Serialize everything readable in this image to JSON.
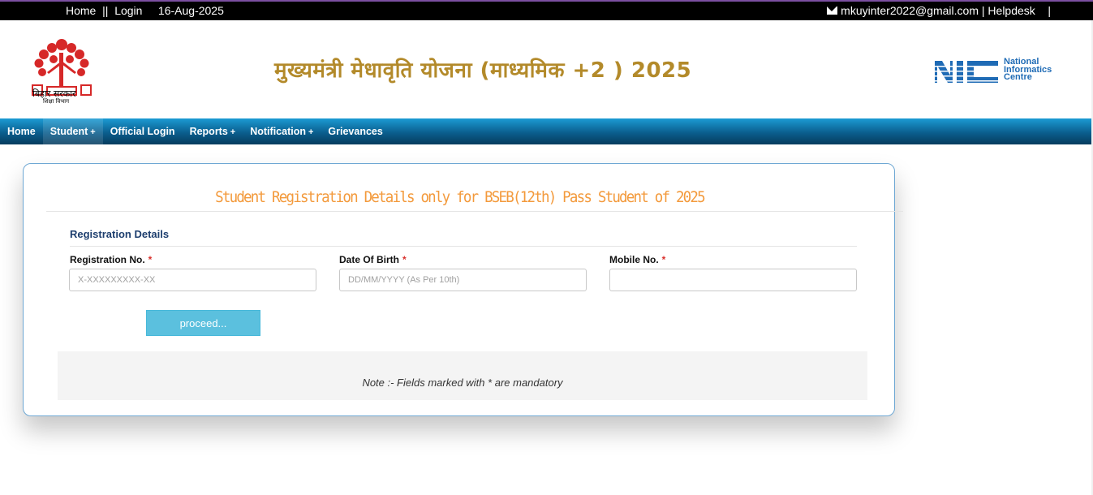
{
  "topbar": {
    "home": "Home",
    "sep1": "  ||  ",
    "login": "Login",
    "date": "16-Aug-2025",
    "email": "mkuyinter2022@gmail.com",
    "sep2": " | ",
    "helpdesk": "Helpdesk",
    "sep3": "    |"
  },
  "header": {
    "emblem_line1": "बिहार सरकार",
    "emblem_line2": "शिक्षा विभाग",
    "title": "मुख्यमंत्री  मेधावृति योजना (माध्यमिक +2 ) 2025",
    "nic_line1": "National",
    "nic_line2": "Informatics",
    "nic_line3": "Centre"
  },
  "nav": {
    "items": [
      {
        "label": "Home",
        "plus": ""
      },
      {
        "label": "Student",
        "plus": "+"
      },
      {
        "label": "Official Login",
        "plus": ""
      },
      {
        "label": "Reports",
        "plus": "+"
      },
      {
        "label": "Notification",
        "plus": "+"
      },
      {
        "label": "Grievances",
        "plus": ""
      }
    ]
  },
  "form": {
    "heading": "Student Registration Details only for BSEB(12th) Pass Student of 2025",
    "section": "Registration Details",
    "required_mark": "*",
    "fields": [
      {
        "label": "Registration No.",
        "placeholder": "X-XXXXXXXXX-XX",
        "value": ""
      },
      {
        "label": "Date Of Birth",
        "placeholder": "DD/MM/YYYY (As Per 10th)",
        "value": ""
      },
      {
        "label": "Mobile No.",
        "placeholder": "",
        "value": ""
      }
    ],
    "proceed_label": "proceed...",
    "note": "Note :- Fields marked with * are mandatory"
  },
  "colors": {
    "title_gold": "#b38a2a",
    "heading_orange": "#f39a3c",
    "section_navy": "#1d3e6e",
    "button_blue": "#5bc0de",
    "nav_blue": "#0b5e8e",
    "required_red": "#d9302c"
  }
}
